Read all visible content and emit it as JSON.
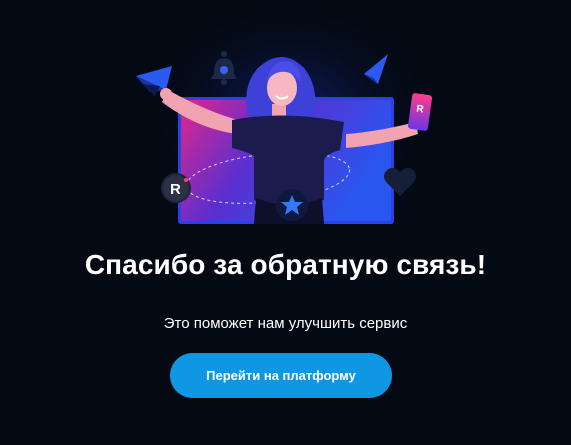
{
  "illustration": {
    "alt_icons": [
      "paper-plane-icon",
      "bell-icon",
      "heart-icon",
      "star-icon",
      "brand-logo-icon"
    ],
    "logo_letter": "R"
  },
  "message": {
    "title": "Спасибо за обратную связь!",
    "subtitle": "Это поможет нам улучшить сервис"
  },
  "cta": {
    "label": "Перейти на платформу"
  },
  "colors": {
    "background": "#040a14",
    "button": "#0f97e4",
    "text": "#ffffff",
    "accent_blue": "#2f4ff2",
    "accent_pink": "#d92c8a"
  }
}
